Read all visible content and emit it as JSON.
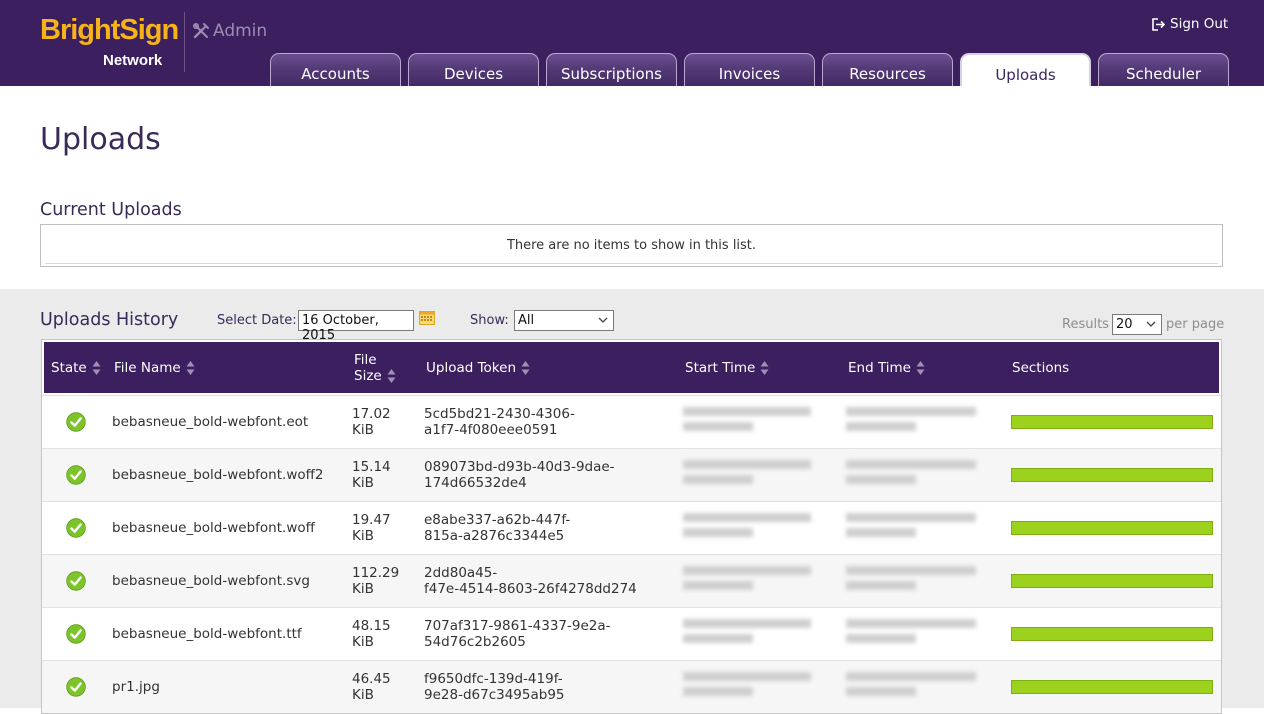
{
  "header": {
    "logo_brand": "BrightSign",
    "logo_sub": "Network",
    "admin_label": "Admin",
    "sign_out": "Sign Out",
    "tabs": [
      {
        "label": "Accounts",
        "active": false
      },
      {
        "label": "Devices",
        "active": false
      },
      {
        "label": "Subscriptions",
        "active": false
      },
      {
        "label": "Invoices",
        "active": false
      },
      {
        "label": "Resources",
        "active": false
      },
      {
        "label": "Uploads",
        "active": true
      },
      {
        "label": "Scheduler",
        "active": false
      }
    ]
  },
  "page_title": "Uploads",
  "current_uploads": {
    "title": "Current Uploads",
    "empty_message": "There are no items to show in this list."
  },
  "history": {
    "title": "Uploads History",
    "select_date_label": "Select Date:",
    "select_date_value": "16 October, 2015",
    "show_label": "Show:",
    "show_value": "All",
    "results_label": "Results",
    "results_value": "20",
    "per_page_label": "per page",
    "columns": [
      "State",
      "File Name",
      "File Size",
      "Upload Token",
      "Start Time",
      "End Time",
      "Sections"
    ],
    "column_size_line1": "File",
    "column_size_line2": "Size",
    "rows": [
      {
        "state": "complete",
        "file_name": "bebasneue_bold-webfont.eot",
        "size_value": "17.02",
        "size_unit": "KiB",
        "token_1": "5cd5bd21-2430-4306-",
        "token_2": "a1f7-4f080eee0591",
        "sections_progress": 1.0
      },
      {
        "state": "complete",
        "file_name": "bebasneue_bold-webfont.woff2",
        "size_value": "15.14",
        "size_unit": "KiB",
        "token_1": "089073bd-d93b-40d3-9dae-",
        "token_2": "174d66532de4",
        "sections_progress": 1.0
      },
      {
        "state": "complete",
        "file_name": "bebasneue_bold-webfont.woff",
        "size_value": "19.47",
        "size_unit": "KiB",
        "token_1": "e8abe337-a62b-447f-",
        "token_2": "815a-a2876c3344e5",
        "sections_progress": 1.0
      },
      {
        "state": "complete",
        "file_name": "bebasneue_bold-webfont.svg",
        "size_value": "112.29",
        "size_unit": "KiB",
        "token_1": "2dd80a45-",
        "token_2": "f47e-4514-8603-26f4278dd274",
        "sections_progress": 1.0
      },
      {
        "state": "complete",
        "file_name": "bebasneue_bold-webfont.ttf",
        "size_value": "48.15",
        "size_unit": "KiB",
        "token_1": "707af317-9861-4337-9e2a-",
        "token_2": "54d76c2b2605",
        "sections_progress": 1.0
      },
      {
        "state": "complete",
        "file_name": "pr1.jpg",
        "size_value": "46.45",
        "size_unit": "KiB",
        "token_1": "f9650dfc-139d-419f-",
        "token_2": "9e28-d67c3495ab95",
        "sections_progress": 1.0
      }
    ]
  },
  "colors": {
    "header_bg": "#3b1f5f",
    "brand_orange": "#f6b31a",
    "progress_green": "#9cd11d",
    "check_green": "#7dc42a"
  }
}
